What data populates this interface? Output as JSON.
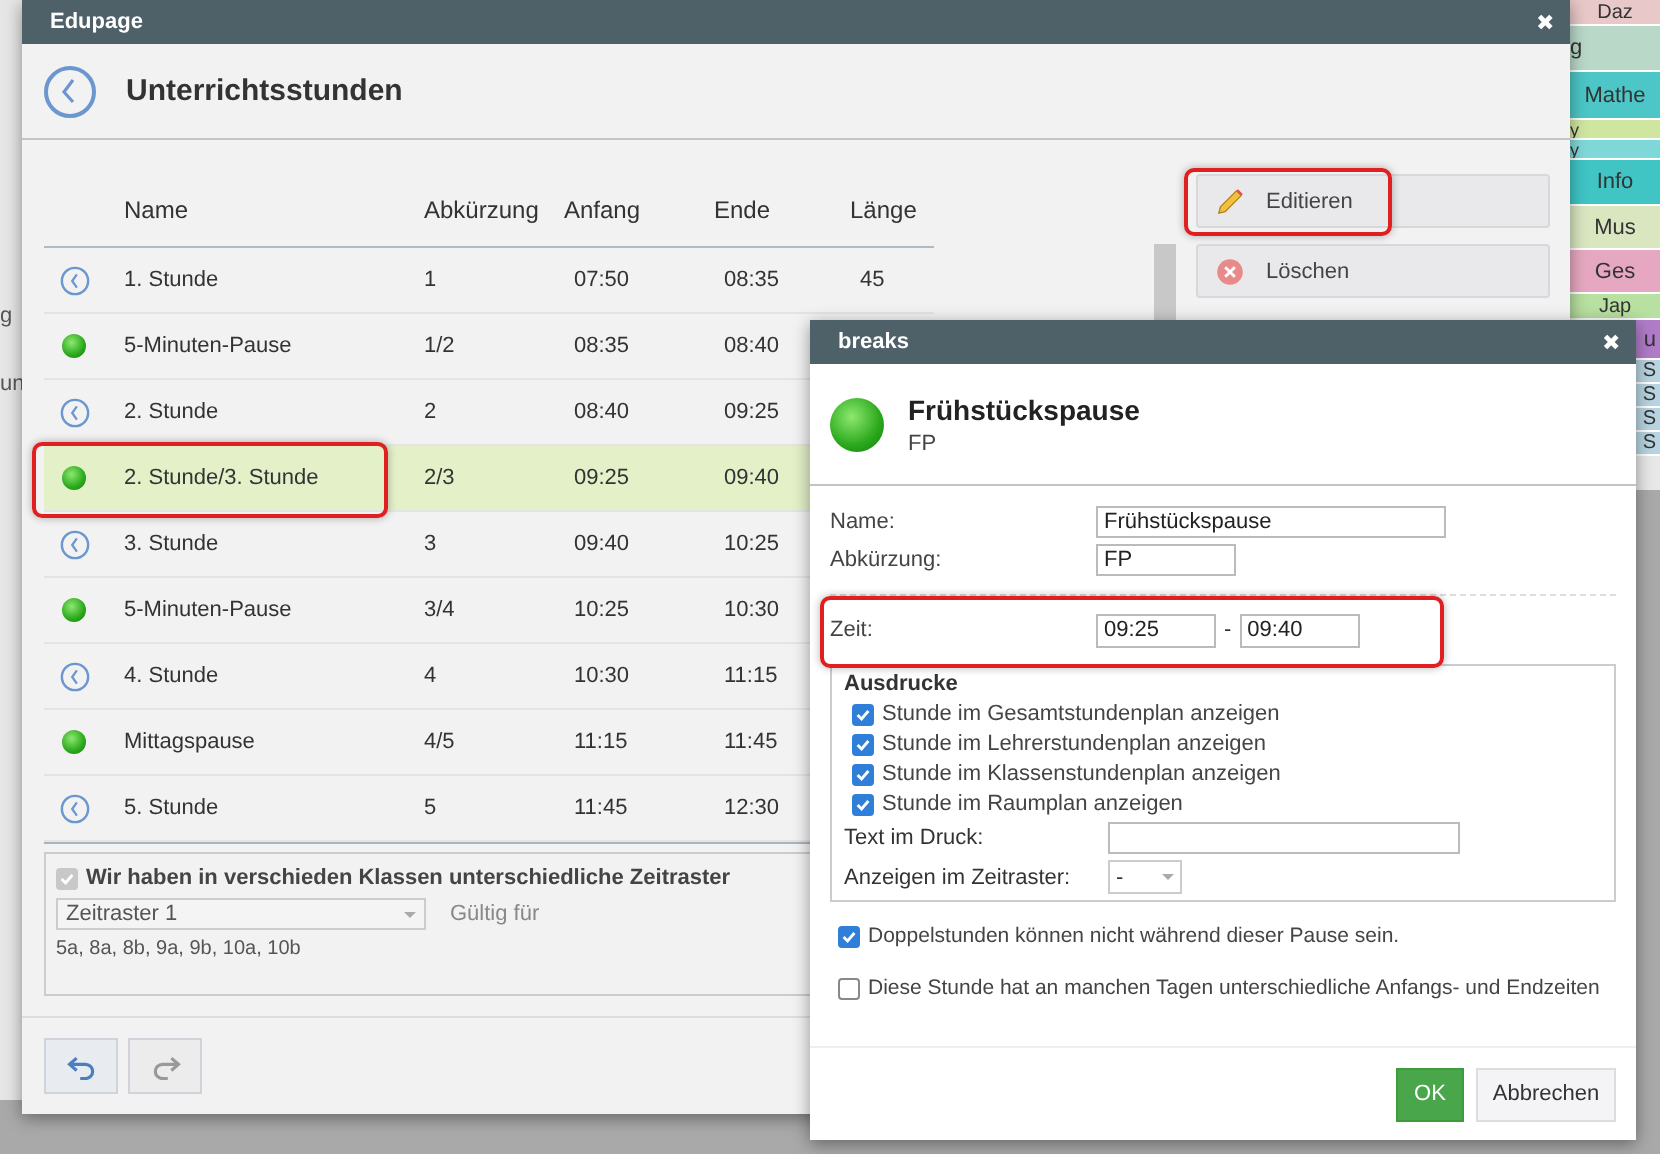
{
  "background": {
    "left_fragments": [
      "g",
      "un"
    ],
    "timetable_cells": [
      {
        "text": "Daz",
        "color": "#e8c8c8"
      },
      {
        "text": "g",
        "color": "#b9d8c8"
      },
      {
        "text": "Mathe",
        "color": "#4cc6c6"
      },
      {
        "text": "y",
        "color": "#cfe6a0"
      },
      {
        "text": "y",
        "color": "#7fd8d8"
      },
      {
        "text": "Info",
        "color": "#40c4c4"
      },
      {
        "text": "Mus",
        "color": "#d9e6c0"
      },
      {
        "text": "Ges",
        "color": "#e6a8c0"
      },
      {
        "text": "Jap",
        "color": "#b8e0a0"
      },
      {
        "text": "u",
        "color": "#b07cc8"
      },
      {
        "text": "S",
        "color": "#b8d4e0"
      },
      {
        "text": "S",
        "color": "#b8d4e0"
      },
      {
        "text": "S",
        "color": "#b8d4e0"
      },
      {
        "text": "S",
        "color": "#b8d4e0"
      }
    ]
  },
  "main_window": {
    "title": "Edupage",
    "close": "✖",
    "heading": "Unterrichtsstunden",
    "table": {
      "columns": [
        "Name",
        "Abkürzung",
        "Anfang",
        "Ende",
        "Länge"
      ],
      "rows": [
        {
          "kind": "lesson",
          "name": "1. Stunde",
          "abbr": "1",
          "start": "07:50",
          "end": "08:35",
          "length": "45",
          "selected": false,
          "highlighted": false
        },
        {
          "kind": "break",
          "name": "5-Minuten-Pause",
          "abbr": "1/2",
          "start": "08:35",
          "end": "08:40",
          "selected": false,
          "highlighted": false
        },
        {
          "kind": "lesson",
          "name": "2. Stunde",
          "abbr": "2",
          "start": "08:40",
          "end": "09:25",
          "selected": false,
          "highlighted": false
        },
        {
          "kind": "break",
          "name": "2. Stunde/3. Stunde",
          "abbr": "2/3",
          "start": "09:25",
          "end": "09:40",
          "selected": true,
          "highlighted": true
        },
        {
          "kind": "lesson",
          "name": "3. Stunde",
          "abbr": "3",
          "start": "09:40",
          "end": "10:25",
          "selected": false,
          "highlighted": false
        },
        {
          "kind": "break",
          "name": "5-Minuten-Pause",
          "abbr": "3/4",
          "start": "10:25",
          "end": "10:30",
          "selected": false,
          "highlighted": false
        },
        {
          "kind": "lesson",
          "name": "4. Stunde",
          "abbr": "4",
          "start": "10:30",
          "end": "11:15",
          "selected": false,
          "highlighted": false
        },
        {
          "kind": "break",
          "name": "Mittagspause",
          "abbr": "4/5",
          "start": "11:15",
          "end": "11:45",
          "selected": false,
          "highlighted": false
        },
        {
          "kind": "lesson",
          "name": "5. Stunde",
          "abbr": "5",
          "start": "11:45",
          "end": "12:30",
          "selected": false,
          "highlighted": false
        }
      ]
    },
    "actions": [
      {
        "kind": "edit",
        "label": "Editieren",
        "highlighted": true
      },
      {
        "kind": "delete",
        "label": "Löschen",
        "highlighted": false
      }
    ],
    "timegrids": {
      "checkbox_label": "Wir haben in verschieden Klassen unterschiedliche Zeitraster",
      "checked": true,
      "disabled": true,
      "select_value": "Zeitraster 1",
      "valid_label": "Gültig für",
      "classes": "5a, 8a, 8b, 9a, 9b, 10a, 10b"
    },
    "footer_buttons": [
      {
        "kind": "undo",
        "disabled": false
      },
      {
        "kind": "redo",
        "disabled": true
      }
    ]
  },
  "break_dialog": {
    "title": "breaks",
    "close": "✖",
    "name": "Frühstückspause",
    "abbr": "FP",
    "fields": [
      {
        "label": "Name:",
        "value": "Frühstückspause",
        "kind": "wide"
      },
      {
        "label": "Abkürzung:",
        "value": "FP",
        "kind": "short"
      }
    ],
    "time": {
      "label": "Zeit:",
      "from": "09:25",
      "separator": "-",
      "to": "09:40",
      "highlighted": true
    },
    "prints": {
      "title": "Ausdrucke",
      "options": [
        {
          "label": "Stunde im Gesamtstundenplan anzeigen",
          "checked": true
        },
        {
          "label": "Stunde im Lehrerstundenplan anzeigen",
          "checked": true
        },
        {
          "label": "Stunde im Klassenstundenplan anzeigen",
          "checked": true
        },
        {
          "label": "Stunde im Raumplan anzeigen",
          "checked": true
        }
      ],
      "text_label": "Text im Druck:",
      "grid_label": "Anzeigen im Zeitraster:",
      "grid_value": "-"
    },
    "options": [
      {
        "label": "Doppelstunden können nicht während dieser Pause sein.",
        "checked": true
      },
      {
        "label": "Diese Stunde hat an manchen Tagen unterschiedliche Anfangs- und Endzeiten",
        "checked": false
      }
    ],
    "buttons": [
      {
        "kind": "primary",
        "label": "OK"
      },
      {
        "kind": "secondary",
        "label": "Abbrechen"
      }
    ]
  }
}
